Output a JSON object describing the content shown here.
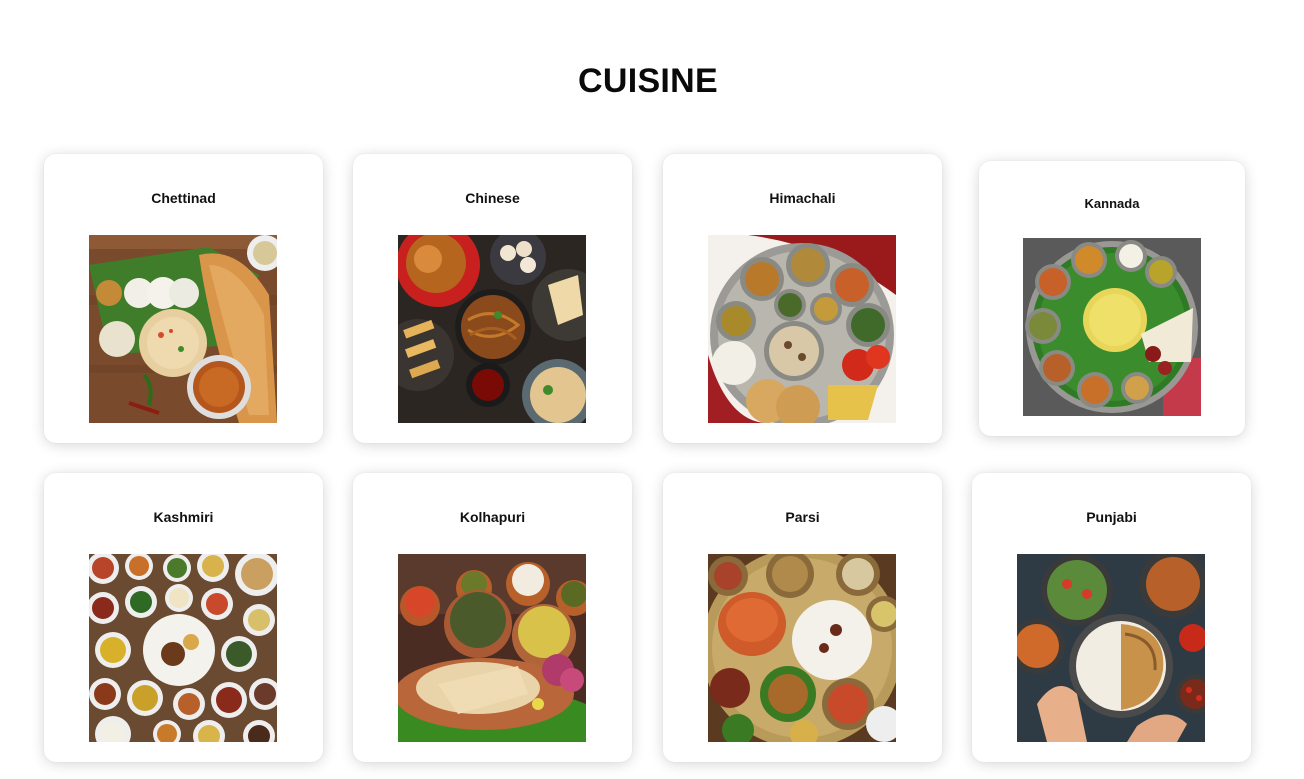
{
  "page": {
    "title": "CUISINE"
  },
  "cuisines": [
    {
      "label": "Chettinad",
      "image": "chettinad-dishes-photo"
    },
    {
      "label": "Chinese",
      "image": "chinese-dishes-photo"
    },
    {
      "label": "Himachali",
      "image": "himachali-thali-photo"
    },
    {
      "label": "Kannada",
      "image": "kannada-meal-photo"
    },
    {
      "label": "Kashmiri",
      "image": "kashmiri-spread-photo"
    },
    {
      "label": "Kolhapuri",
      "image": "kolhapuri-meal-photo"
    },
    {
      "label": "Parsi",
      "image": "parsi-spread-photo"
    },
    {
      "label": "Punjabi",
      "image": "punjabi-meal-photo"
    }
  ]
}
